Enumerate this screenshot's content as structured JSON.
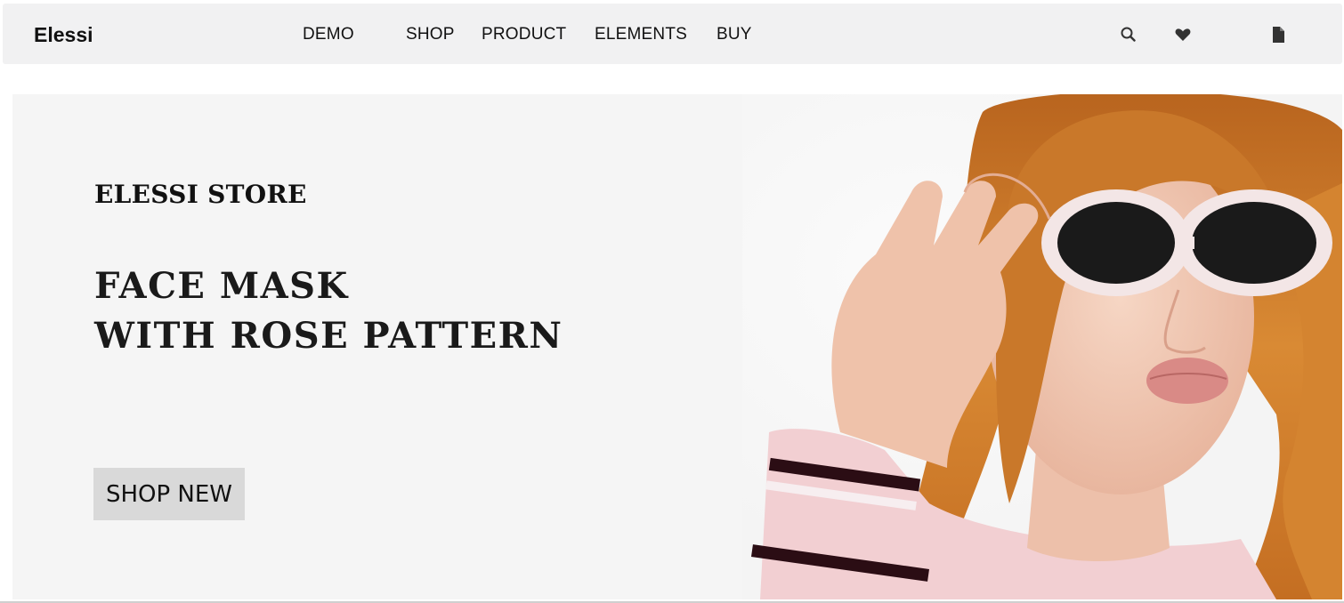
{
  "header": {
    "logo": "Elessi",
    "nav": [
      "DEMO",
      "SHOP",
      "PRODUCT",
      "ELEMENTS",
      "BUY"
    ],
    "icons": [
      "search-icon",
      "heart-icon",
      "document-icon"
    ]
  },
  "hero": {
    "subtitle": "ELESSI STORE",
    "title_line1": "FACE MASK",
    "title_line2": "WITH ROSE PATTERN",
    "button_label": "SHOP NEW"
  },
  "colors": {
    "navbar_bg": "#f1f1f2",
    "hero_bg": "#f5f5f5",
    "button_bg": "#d9d9d9",
    "text": "#111111"
  }
}
